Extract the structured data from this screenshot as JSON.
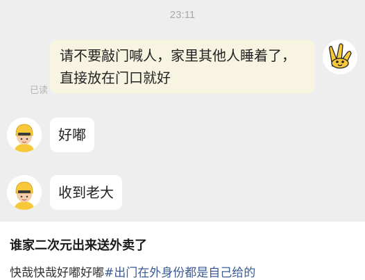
{
  "chat": {
    "timestamp": "23:11",
    "messages": [
      {
        "sender": "self",
        "text": "请不要敲门喊人，家里其他人睡着了，直接放在门口就好",
        "status": "已读"
      },
      {
        "sender": "other",
        "text": "好嘟"
      },
      {
        "sender": "other",
        "text": "收到老大"
      }
    ]
  },
  "post": {
    "title": "谁家二次元出来送外卖了",
    "body_text": "快哉快哉好嘟好嘟",
    "hashtag": "#出门在外身份都是自己给的"
  },
  "colors": {
    "chat_background": "#eeeeee",
    "self_bubble": "#f8f4e2",
    "other_bubble": "#ffffff",
    "hashtag": "#3a5a94",
    "avatar_yellow": "#f7c93a"
  },
  "icons": {
    "self_avatar": "yellow-hand-character",
    "other_avatar": "yellow-helmet-character"
  }
}
